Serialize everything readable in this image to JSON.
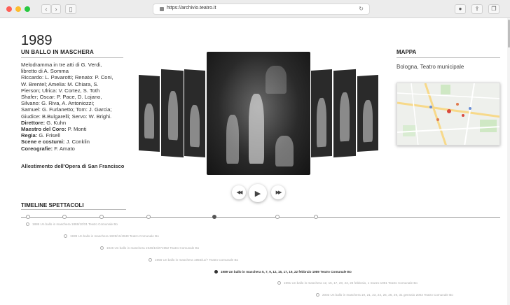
{
  "browser": {
    "url": "https://archivio.teatro.it",
    "traffic_colors": [
      "#fe5f57",
      "#febc2e",
      "#28c840"
    ]
  },
  "header": {
    "year": "1989",
    "title": "UN BALLO IN MASCHERA"
  },
  "details": [
    {
      "label": "",
      "text": "Melodramma in tre atti di G. Verdi,"
    },
    {
      "label": "",
      "text": "libretto di A. Somma"
    },
    {
      "label": "",
      "text": "Riccardo: L. Pavarotti; Renato: P. Coni,"
    },
    {
      "label": "",
      "text": "W. Brentel; Amelia: M. Chiara, S."
    },
    {
      "label": "",
      "text": "Pierson; Ulrica: V. Cortez, S. Toth"
    },
    {
      "label": "",
      "text": "Shafer; Oscar: P. Pace, D. Lojano,"
    },
    {
      "label": "",
      "text": "Silvano: G. Riva, A. Antoniozzi;"
    },
    {
      "label": "",
      "text": "Samuel: G. Furlanetto; Tom: J. Garcia;"
    },
    {
      "label": "",
      "text": "Giudice: B.Bulgarelli; Servo: W. Brighi."
    },
    {
      "label": "Direttore:",
      "text": " G. Kuhn"
    },
    {
      "label": "Maestro del Coro:",
      "text": " P. Monti"
    },
    {
      "label": "Regia:",
      "text": " G. Frisell"
    },
    {
      "label": "Scene e costumi:",
      "text": " J. Conklin"
    },
    {
      "label": "Coreografie:",
      "text": " F. Amato"
    }
  ],
  "production": "Allestimento dell'Opera di San Francisco",
  "map": {
    "heading": "MAPPA",
    "place": "Bologna, Teatro municipale"
  },
  "timeline": {
    "heading": "TIMELINE SPETTACOLI",
    "entries": [
      {
        "text": "1886 Un ballo in maschera 1886/10/31 Teatro Comunale Bo",
        "active": false
      },
      {
        "text": "1939 Un ballo in maschera 1939/11/4949 Teatro Comunale Bo",
        "active": false
      },
      {
        "text": "1946 Un ballo in maschera 1946/10/271952 Teatro Comunale Bo",
        "active": false
      },
      {
        "text": "1956 Un ballo in maschera 1956/11/7 Teatro Comunale Bo",
        "active": false
      },
      {
        "text": "1989 Un ballo in maschera 5, 7, 9, 12, 15, 17, 19, 22 febbraio 1989 Teatro Comunale Bo",
        "active": true
      },
      {
        "text": "1991 Un ballo in maschera 12, 15, 17, 20, 23, 26 febbraio, 1 marzo 1991 Teatro Comunale Bo",
        "active": false
      },
      {
        "text": "2003 Un ballo in maschera 19, 21, 23, 24, 25, 26, 29, 31 gennaio 2003 Teatro Comunale Bo",
        "active": false
      }
    ]
  },
  "controls": {
    "prev": "◀◀",
    "play": "▶",
    "next": "▶▶"
  }
}
